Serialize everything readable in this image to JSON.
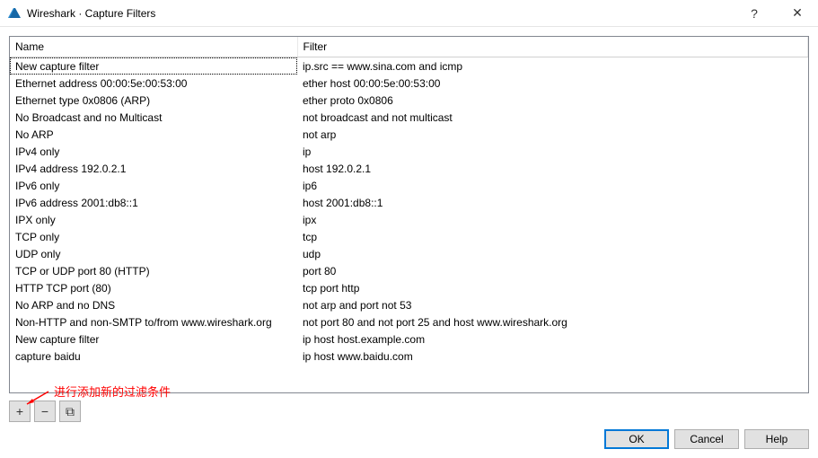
{
  "window": {
    "title": "Wireshark · Capture Filters"
  },
  "table": {
    "headers": {
      "name": "Name",
      "filter": "Filter"
    },
    "rows": [
      {
        "name": "New capture filter",
        "filter": "ip.src == www.sina.com and icmp",
        "selected": true
      },
      {
        "name": "Ethernet address 00:00:5e:00:53:00",
        "filter": "ether host 00:00:5e:00:53:00"
      },
      {
        "name": "Ethernet type 0x0806 (ARP)",
        "filter": "ether proto 0x0806"
      },
      {
        "name": "No Broadcast and no Multicast",
        "filter": "not broadcast and not multicast"
      },
      {
        "name": "No ARP",
        "filter": "not arp"
      },
      {
        "name": "IPv4 only",
        "filter": "ip"
      },
      {
        "name": "IPv4 address 192.0.2.1",
        "filter": "host 192.0.2.1"
      },
      {
        "name": "IPv6 only",
        "filter": "ip6"
      },
      {
        "name": "IPv6 address 2001:db8::1",
        "filter": "host 2001:db8::1"
      },
      {
        "name": "IPX only",
        "filter": "ipx"
      },
      {
        "name": "TCP only",
        "filter": "tcp"
      },
      {
        "name": "UDP only",
        "filter": "udp"
      },
      {
        "name": "TCP or UDP port 80 (HTTP)",
        "filter": "port 80"
      },
      {
        "name": "HTTP TCP port (80)",
        "filter": "tcp port http"
      },
      {
        "name": "No ARP and no DNS",
        "filter": "not arp and port not 53"
      },
      {
        "name": "Non-HTTP and non-SMTP to/from www.wireshark.org",
        "filter": "not port 80 and not port 25 and host www.wireshark.org"
      },
      {
        "name": "New capture filter",
        "filter": "ip host host.example.com"
      },
      {
        "name": "capture baidu",
        "filter": "ip host www.baidu.com"
      }
    ]
  },
  "toolbar": {
    "add_label": "+",
    "remove_label": "−",
    "copy_label": "⧉"
  },
  "annotation": {
    "text": "进行添加新的过滤条件"
  },
  "footer": {
    "ok": "OK",
    "cancel": "Cancel",
    "help": "Help"
  }
}
